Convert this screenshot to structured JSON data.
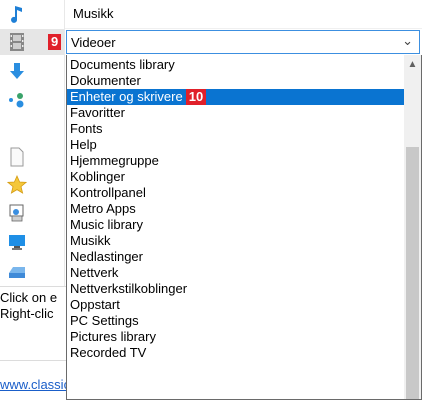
{
  "top_row": {
    "label": "Musikk"
  },
  "combo": {
    "badge": "9",
    "value": "Videoer"
  },
  "dropdown": {
    "items": [
      "Documents library",
      "Dokumenter",
      "Enheter og skrivere",
      "Favoritter",
      "Fonts",
      "Help",
      "Hjemmegruppe",
      "Koblinger",
      "Kontrollpanel",
      "Metro Apps",
      "Music library",
      "Musikk",
      "Nedlastinger",
      "Nettverk",
      "Nettverkstilkoblinger",
      "Oppstart",
      "PC Settings",
      "Pictures library",
      "Recorded TV"
    ],
    "highlight_badge": "10"
  },
  "background": {
    "line1": "Click on e",
    "line2": "Right-clic",
    "link": "www.classics"
  },
  "colors": {
    "highlight": "#0a74d1",
    "badge": "#e0202a",
    "combo_border": "#3c8fe0"
  },
  "icons": [
    "music-note-icon",
    "film-icon",
    "download-arrow-icon",
    "network-icon",
    "document-icon",
    "star-icon",
    "control-panel-icon",
    "monitor-icon",
    "drive-icon"
  ]
}
